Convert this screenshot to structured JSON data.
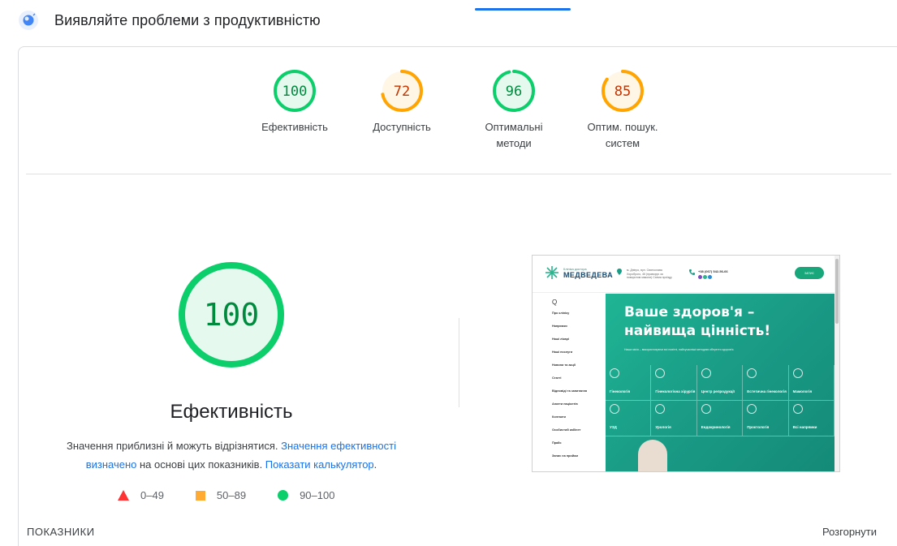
{
  "header": {
    "title": "Виявляйте проблеми з продуктивністю",
    "icon": "lighthouse-icon"
  },
  "gauges": [
    {
      "score": "100",
      "label_line1": "Ефективність",
      "label_line2": "",
      "color": "#0cce6b",
      "fill": "#e6f9ef",
      "text_color": "#008a3e",
      "fraction": 1.0
    },
    {
      "score": "72",
      "label_line1": "Доступність",
      "label_line2": "",
      "color": "#ffa400",
      "fill": "#fff6e6",
      "text_color": "#c33300",
      "fraction": 0.72
    },
    {
      "score": "96",
      "label_line1": "Оптимальні",
      "label_line2": "методи",
      "color": "#0cce6b",
      "fill": "#e6f9ef",
      "text_color": "#008a3e",
      "fraction": 0.96
    },
    {
      "score": "85",
      "label_line1": "Оптим. пошук.",
      "label_line2": "систем",
      "color": "#ffa400",
      "fill": "#fff6e6",
      "text_color": "#c33300",
      "fraction": 0.85
    }
  ],
  "main_gauge": {
    "score": "100",
    "title": "Ефективність",
    "fraction": 1.0,
    "color": "#0cce6b",
    "fill": "#e6f9ef",
    "text_color": "#008a3e"
  },
  "description": {
    "text1": "Значення приблизні й можуть відрізнятися. ",
    "link1": "Значення ефективності визначено",
    "text2": " на основі цих показників. ",
    "link2": "Показати калькулятор",
    "text3": "."
  },
  "legend": [
    {
      "range": "0–49",
      "shape": "triangle",
      "color": "#ff3333"
    },
    {
      "range": "50–89",
      "shape": "square",
      "color": "#ffaa33"
    },
    {
      "range": "90–100",
      "shape": "circle",
      "color": "#0cce6b"
    }
  ],
  "screenshot": {
    "logo_small": "Клініка доктора",
    "logo_big": "МЕДВЕДЕВА",
    "address": "м. Дніпро, вул. Святослава Хороброго, 46 (праворуч за поворотом миколи) Схема проїзду",
    "phone": "+38 (067) 542-56-66",
    "button": "ЗАПИС",
    "search_icon": "Q",
    "menu": [
      "Про клініку",
      "Напрямки",
      "Наші лікарі",
      "Наші послуги",
      "Новини та акції",
      "Статті",
      "Відповіді та запитання",
      "Анкети пацієнтів",
      "Контакти",
      "Особистий кабінет",
      "Прайс",
      "Запис на прийом"
    ],
    "hero_title_1": "Ваше здоров'я –",
    "hero_title_2": "найвища цінність!",
    "hero_sub": "Наша місія – використовуючи всі новітні, найсучасніші методики зберегти здоров'я.",
    "tiles": [
      "Гінекологія",
      "Гінекологічна хірургія",
      "Центр репродукції",
      "Естетична гінекологія",
      "Мамологія",
      "УЗД",
      "Урологія",
      "Ендокринологія",
      "Проктологія",
      "Всі напрямки"
    ]
  },
  "footer": {
    "metrics_label": "ПОКАЗНИКИ",
    "expand_label": "Розгорнути"
  }
}
